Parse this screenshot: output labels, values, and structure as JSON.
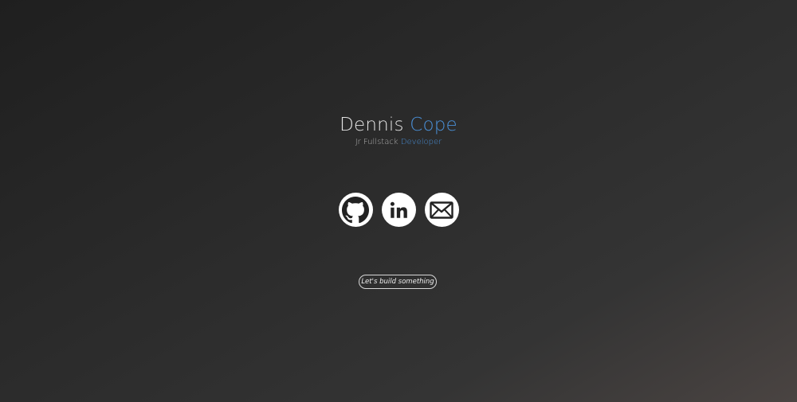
{
  "header": {
    "first_name": "Dennis",
    "last_name": "Cope",
    "role_prefix": "Jr Fullstack",
    "role_accent": "Developer"
  },
  "socials": [
    {
      "icon": "github-icon"
    },
    {
      "icon": "linkedin-icon"
    },
    {
      "icon": "envelope-icon"
    }
  ],
  "cta": {
    "label": "Let's build something"
  },
  "colors": {
    "accent": "#4a8fd6",
    "text": "#e4e4e4",
    "icon_bg": "#ffffff",
    "icon_fg": "#222222"
  }
}
